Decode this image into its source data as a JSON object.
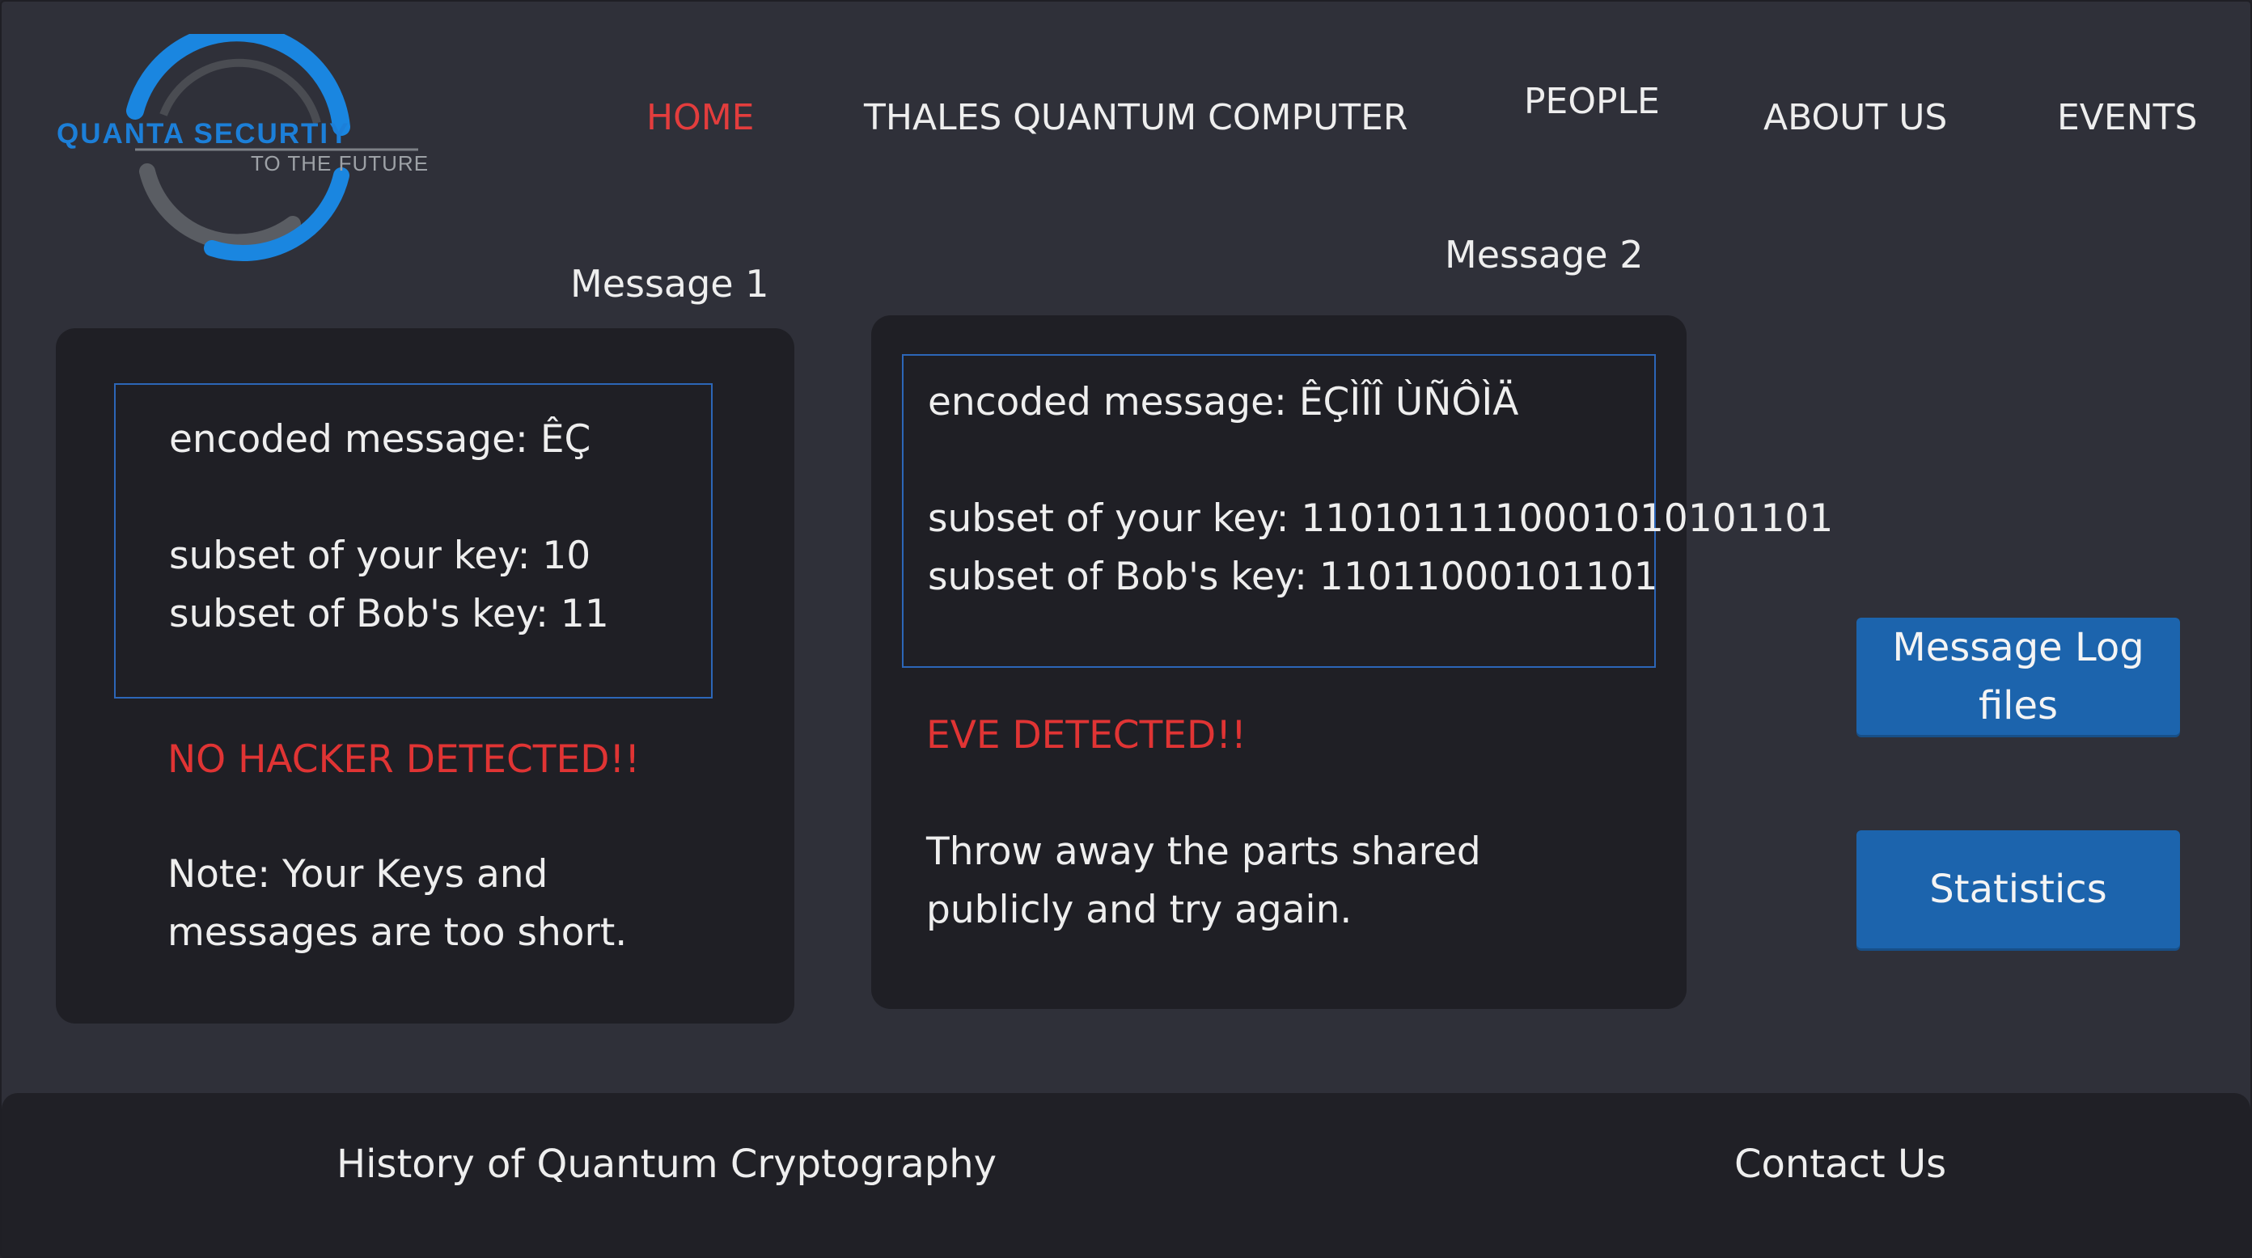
{
  "logo": {
    "title": "QUANTA SECURTIY",
    "subtitle": "TO THE FUTURE"
  },
  "nav": {
    "home": "HOME",
    "thales": "THALES QUANTUM COMPUTER",
    "people": "PEOPLE",
    "about": "ABOUT US",
    "events": "EVENTS",
    "active_color": "#e33d3d"
  },
  "message1": {
    "caption": "Message 1",
    "encoded": "encoded message:   ÊÇ",
    "your_key": "subset of your key: 10",
    "bob_key": "subset of Bob's key:   11",
    "status": "NO HACKER DETECTED!!",
    "note": "Note: Your Keys and messages are too short."
  },
  "message2": {
    "caption": "Message 2",
    "encoded": "encoded message:   ÊÇÌÎÎ  ÙÑÔÌÄ",
    "your_key": "subset of your key:  1101011110001010101101",
    "bob_key": "subset of Bob's key:  11011000101101",
    "status": "EVE DETECTED!!",
    "note": "Throw away the parts shared publicly and try again."
  },
  "buttons": {
    "log_files": "Message Log files",
    "statistics": "Statistics"
  },
  "footer": {
    "history": "History of Quantum Cryptography",
    "contact": "Contact Us"
  },
  "colors": {
    "background": "#2f3039",
    "card": "#1f1f25",
    "accent_blue": "#1c64ad",
    "alert_red": "#e03434"
  }
}
